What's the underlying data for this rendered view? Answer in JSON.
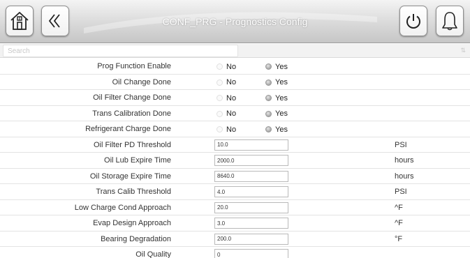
{
  "header": {
    "title": "CONF_PRG - Prognostics Config",
    "left_buttons": [
      "home-icon",
      "double-chevron-left-icon"
    ],
    "right_buttons": [
      "power-icon",
      "bell-icon"
    ]
  },
  "search": {
    "placeholder": "Search",
    "value": ""
  },
  "rows": [
    {
      "label": "Prog Function Enable",
      "type": "radio",
      "options": [
        "No",
        "Yes"
      ],
      "selected": "Yes"
    },
    {
      "label": "Oil Change Done",
      "type": "radio",
      "options": [
        "No",
        "Yes"
      ],
      "selected": "Yes"
    },
    {
      "label": "Oil Filter Change Done",
      "type": "radio",
      "options": [
        "No",
        "Yes"
      ],
      "selected": "Yes"
    },
    {
      "label": "Trans Calibration Done",
      "type": "radio",
      "options": [
        "No",
        "Yes"
      ],
      "selected": "Yes"
    },
    {
      "label": "Refrigerant Charge Done",
      "type": "radio",
      "options": [
        "No",
        "Yes"
      ],
      "selected": "Yes"
    },
    {
      "label": "Oil Filter PD Threshold",
      "type": "input",
      "value": "10.0",
      "unit": "PSI"
    },
    {
      "label": "Oil Lub Expire Time",
      "type": "input",
      "value": "2000.0",
      "unit": "hours"
    },
    {
      "label": "Oil Storage Expire Time",
      "type": "input",
      "value": "8640.0",
      "unit": "hours"
    },
    {
      "label": "Trans Calib Threshold",
      "type": "input",
      "value": "4.0",
      "unit": "PSI"
    },
    {
      "label": "Low Charge Cond Approach",
      "type": "input",
      "value": "20.0",
      "unit": "^F"
    },
    {
      "label": "Evap Design Approach",
      "type": "input",
      "value": "3.0",
      "unit": "^F"
    },
    {
      "label": "Bearing Degradation",
      "type": "input",
      "value": "200.0",
      "unit": "°F"
    },
    {
      "label": "Oil Quality",
      "type": "input",
      "value": "0",
      "unit": ""
    }
  ]
}
